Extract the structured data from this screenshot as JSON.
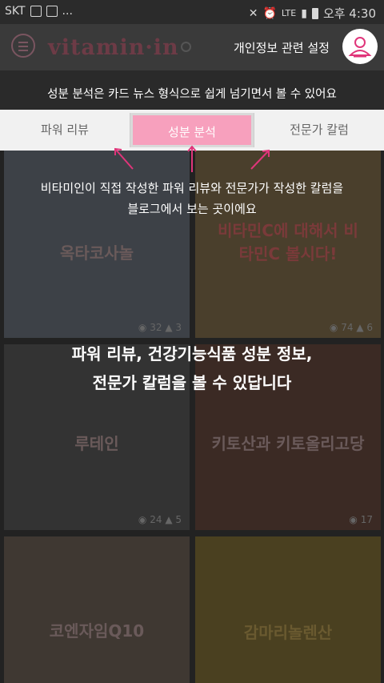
{
  "status_bar": {
    "carrier": "SKT",
    "extra": "...",
    "network": "LTE",
    "time": "오후 4:30"
  },
  "header": {
    "logo": "vitamin·in",
    "privacy_label": "개인정보 관련 설정"
  },
  "tabs": [
    {
      "label": "파워 리뷰",
      "active": false
    },
    {
      "label": "성분 분석",
      "active": true
    },
    {
      "label": "전문가 칼럼",
      "active": false
    }
  ],
  "tutorial": {
    "tip_top": "성분 분석은 카드 뉴스 형식으로 쉽게 넘기면서 볼 수 있어요",
    "tip_middle": [
      "비타미인이 직접 작성한 파워 리뷰와 전문가가 작성한 칼럼을",
      "블로그에서 보는 곳이에요"
    ],
    "tip_main": [
      "파워 리뷰, 건강기능식품 성분 정보,",
      "전문가 칼럼을 볼 수 있답니다"
    ]
  },
  "cards": [
    {
      "title": "옥타코사놀",
      "views": "32",
      "likes": "3"
    },
    {
      "title": "비타민C에 대해서 비타민C 볼시다!",
      "views": "74",
      "likes": "6"
    },
    {
      "title": "루테인",
      "views": "24",
      "likes": "5"
    },
    {
      "title": "키토산과 키토올리고당",
      "views": "17",
      "likes": ""
    },
    {
      "title": "코엔자임Q10",
      "views": "",
      "likes": ""
    },
    {
      "title": "감마리놀렌산",
      "views": "",
      "likes": ""
    }
  ],
  "colors": {
    "accent": "#f7a0bd",
    "arrow": "#e0357a"
  }
}
